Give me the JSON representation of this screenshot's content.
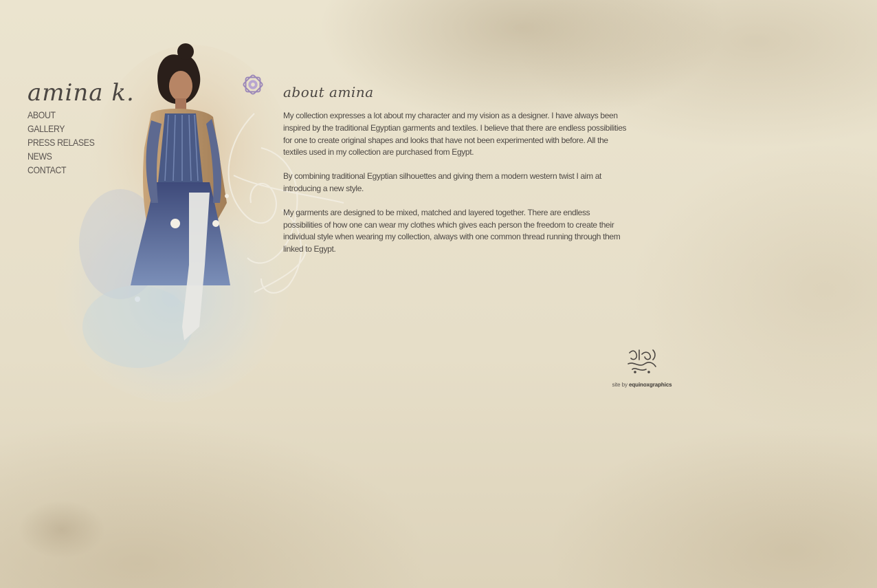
{
  "brand": {
    "logo_text": "amina k."
  },
  "nav": {
    "items": [
      {
        "label": "ABOUT"
      },
      {
        "label": "GALLERY"
      },
      {
        "label": "PRESS RELASES"
      },
      {
        "label": "NEWS"
      },
      {
        "label": "CONTACT"
      }
    ]
  },
  "main": {
    "heading": "about amina",
    "paragraphs": [
      "My collection expresses a lot about my character and my vision as a designer. I have always been inspired by the traditional Egyptian garments and textiles. I believe that there are endless possibilities for one to create original shapes and looks that have not been experimented with before.  All the textiles used in my collection are purchased from Egypt.",
      " By combining traditional Egyptian silhouettes and giving them a modern western twist I aim at introducing a new style.",
      "My garments are designed to be mixed, matched and layered together. There are endless possibilities of how one can wear my clothes which gives each person the freedom to create their individual style when wearing my collection, always with one common thread running through them linked to Egypt."
    ]
  },
  "footer": {
    "credit_prefix": "site by",
    "credit_name": "equinoxgraphics"
  },
  "icons": {
    "rosette": "rosette-ornament-icon",
    "calligraphy": "arabic-calligraphy-icon"
  },
  "colors": {
    "background": "#e9e1cc",
    "text": "#4e4945",
    "rosette": "#9a86b8"
  }
}
